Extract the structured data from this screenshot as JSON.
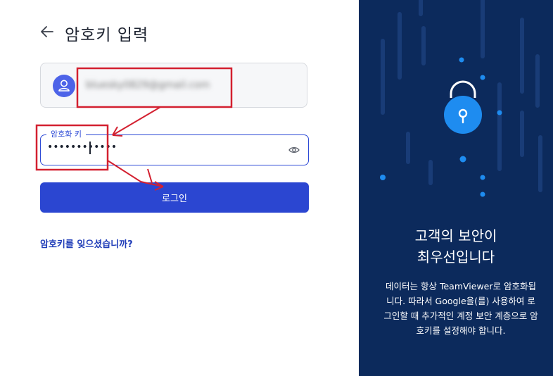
{
  "header": {
    "title": "암호키 입력"
  },
  "account": {
    "email": "bluesky0829@gmail.com"
  },
  "password_field": {
    "label": "암호화 키",
    "value": "••••••••••••"
  },
  "login_button": {
    "label": "로그인"
  },
  "forgot_link": {
    "label": "암호키를 잊으셨습니까?"
  },
  "promo": {
    "title_line1": "고객의 보안이",
    "title_line2": "최우선입니다",
    "description": "데이터는 항상 TeamViewer로 암호화됩니다. 따라서 Google을(를) 사용하여 로그인할 때 추가적인 계정 보안 계층으로 암호키를 설정해야 합니다."
  },
  "colors": {
    "panel": "#0c2a5c",
    "accent": "#2b46d1",
    "lock": "#1e8cf0",
    "annotation": "#d32030"
  }
}
